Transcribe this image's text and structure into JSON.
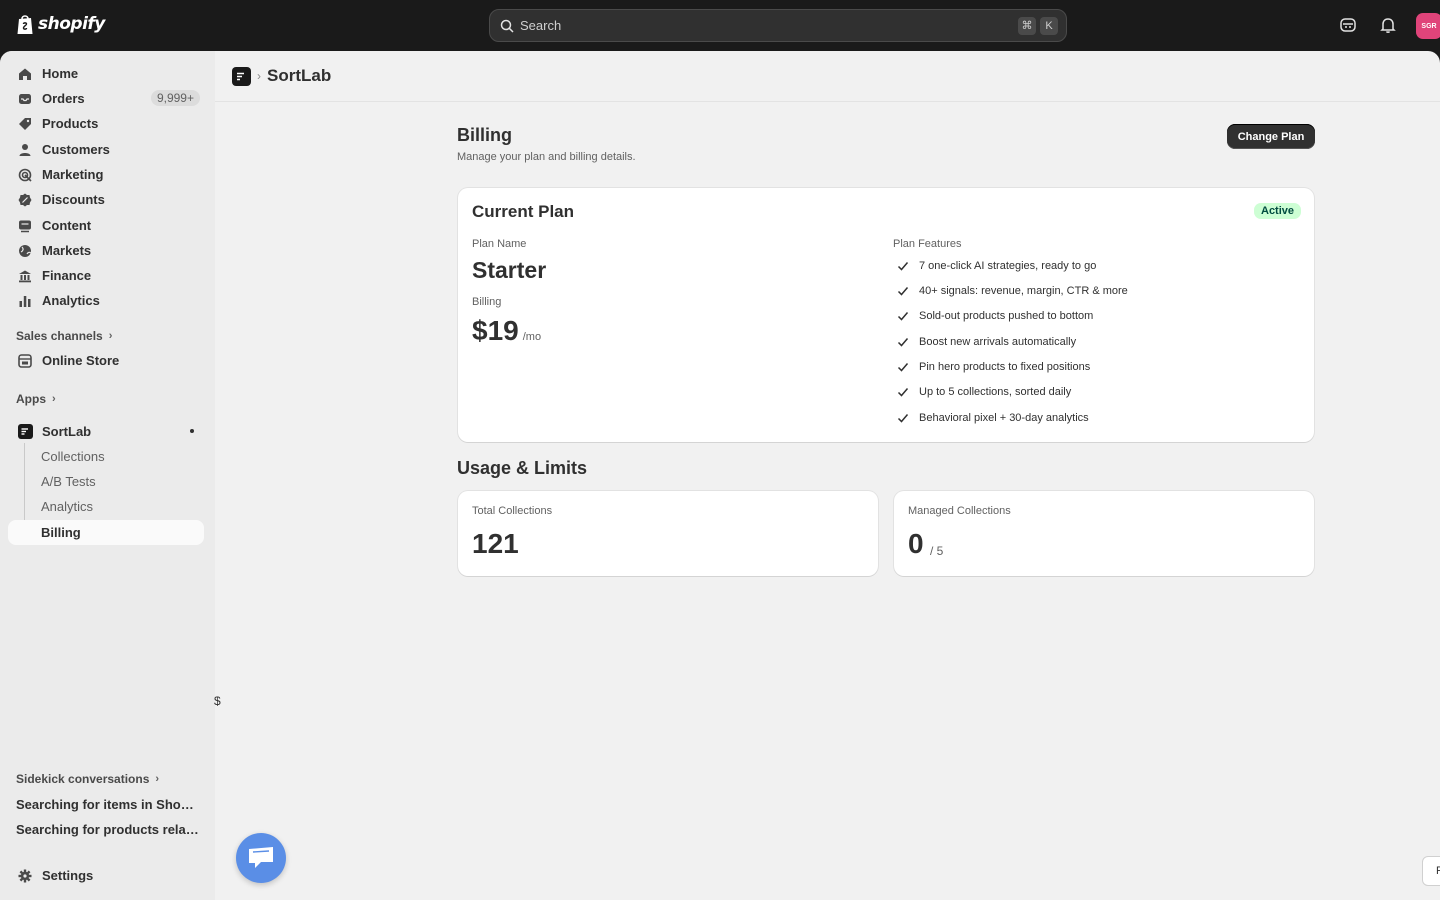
{
  "topbar": {
    "logo_text": "shopify",
    "search_placeholder": "Search",
    "shortcut_keys": [
      "⌘",
      "K"
    ],
    "avatar_initials": "SGR"
  },
  "sidebar": {
    "items": [
      {
        "label": "Home",
        "icon": "home-icon"
      },
      {
        "label": "Orders",
        "icon": "inbox-icon",
        "badge": "9,999+"
      },
      {
        "label": "Products",
        "icon": "tag-icon"
      },
      {
        "label": "Customers",
        "icon": "person-icon"
      },
      {
        "label": "Marketing",
        "icon": "target-icon"
      },
      {
        "label": "Discounts",
        "icon": "discount-icon"
      },
      {
        "label": "Content",
        "icon": "content-icon"
      },
      {
        "label": "Markets",
        "icon": "globe-icon"
      },
      {
        "label": "Finance",
        "icon": "bank-icon"
      },
      {
        "label": "Analytics",
        "icon": "bar-chart-icon"
      }
    ],
    "sales_channels_title": "Sales channels",
    "online_store": "Online Store",
    "apps_title": "Apps",
    "app_name": "SortLab",
    "app_sub_items": [
      "Collections",
      "A/B Tests",
      "Analytics",
      "Billing"
    ],
    "sidekick_title": "Sidekick conversations",
    "sidekick_items": [
      "Searching for items in Shopify ...",
      "Searching for products related..."
    ],
    "settings": "Settings"
  },
  "header": {
    "app_name": "SortLab"
  },
  "page": {
    "title": "Billing",
    "subtitle": "Manage your plan and billing details.",
    "change_plan_label": "Change Plan"
  },
  "current_plan": {
    "title": "Current Plan",
    "status": "Active",
    "plan_name_label": "Plan Name",
    "plan_name": "Starter",
    "billing_label": "Billing",
    "price": "$19",
    "period": "/mo",
    "features_label": "Plan Features",
    "features": [
      "7 one-click AI strategies, ready to go",
      "40+ signals: revenue, margin, CTR & more",
      "Sold-out products pushed to bottom",
      "Boost new arrivals automatically",
      "Pin hero products to fixed positions",
      "Up to 5 collections, sorted daily",
      "Behavioral pixel + 30-day analytics"
    ]
  },
  "usage": {
    "title": "Usage & Limits",
    "total_label": "Total Collections",
    "total_value": "121",
    "managed_label": "Managed Collections",
    "managed_value": "0",
    "managed_limit": "/ 5"
  },
  "misc": {
    "dollar": "$",
    "edge_btn": "F"
  },
  "colors": {
    "topbar": "#1a1a1a",
    "active_badge_bg": "#cdfed4",
    "chat_fab": "#5a8ee6",
    "avatar": "#e0447a"
  }
}
